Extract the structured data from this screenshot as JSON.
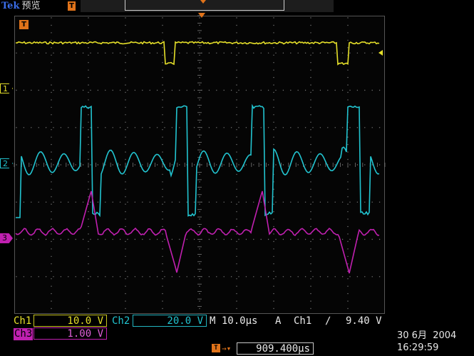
{
  "header": {
    "brand": "Tek",
    "mode": "预览",
    "trig_marker": "T"
  },
  "graticule": {
    "t_marker": "T",
    "ch_markers": {
      "ch1": "1",
      "ch2": "2",
      "ch3": "3"
    }
  },
  "channels": [
    {
      "name": "Ch1",
      "scale": "10.0 V",
      "color": "#e6e02a"
    },
    {
      "name": "Ch2",
      "scale": "20.0 V",
      "color": "#22c4d0"
    },
    {
      "name": "Ch3",
      "scale": "1.00 V",
      "color": "#c020b0"
    }
  ],
  "timebase": {
    "label": "M 10.0µs"
  },
  "trigger": {
    "mode": "A",
    "source": "Ch1",
    "slope_symbol": "∕",
    "level": "9.40 V"
  },
  "trigger_position": {
    "value": "909.400µs"
  },
  "datetime": {
    "date": "30 6月  2004",
    "time": "16:29:59"
  }
}
